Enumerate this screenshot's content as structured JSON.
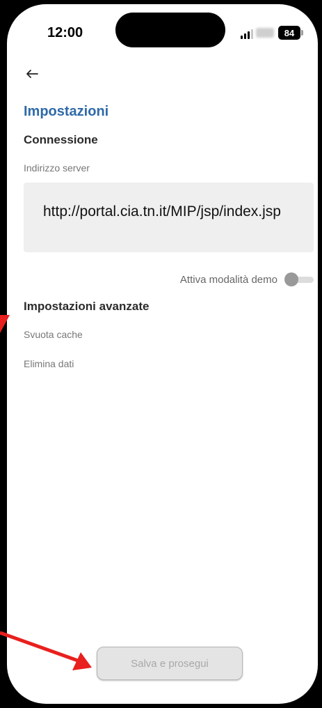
{
  "status_bar": {
    "time": "12:00",
    "battery": "84"
  },
  "header": {
    "back_icon": "arrow-left-icon",
    "title": "Impostazioni"
  },
  "connection": {
    "section_title": "Connessione",
    "server_label": "Indirizzo server",
    "server_value": "http://portal.cia.tn.it/MIP/jsp/index.jsp",
    "demo_label": "Attiva modalità demo",
    "demo_enabled": false
  },
  "advanced": {
    "section_title": "Impostazioni avanzate",
    "clear_cache": "Svuota cache",
    "delete_data": "Elimina dati"
  },
  "footer": {
    "save_label": "Salva e prosegui"
  },
  "colors": {
    "accent": "#2f6aa8",
    "annotation": "#e8201e"
  }
}
